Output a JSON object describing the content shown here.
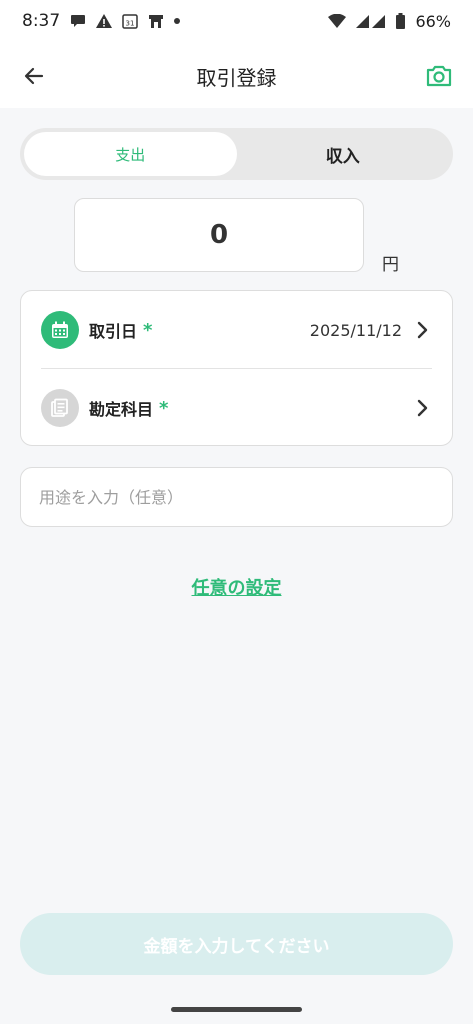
{
  "status_bar": {
    "time": "8:37",
    "calendar_day": "31",
    "battery": "66%",
    "icons": [
      "chat-icon",
      "warning-icon",
      "calendar-icon",
      "store-icon",
      "dot-icon",
      "wifi-icon",
      "signal-icon",
      "battery-icon"
    ]
  },
  "header": {
    "title": "取引登録",
    "back_icon": "arrow-left-icon",
    "camera_icon": "camera-icon"
  },
  "segment": {
    "expense_label": "支出",
    "income_label": "収入",
    "selected": "支出"
  },
  "amount": {
    "value": "0",
    "unit": "円"
  },
  "fields": {
    "date_label": "取引日",
    "date_required": "*",
    "date_value": "2025/11/12",
    "account_label": "勘定科目",
    "account_required": "*"
  },
  "memo": {
    "placeholder": "用途を入力（任意）"
  },
  "optional_settings": "任意の設定",
  "submit": {
    "label": "金額を入力してください"
  },
  "colors": {
    "accent": "#2fbb79",
    "disabled_button": "#d9eeee"
  }
}
